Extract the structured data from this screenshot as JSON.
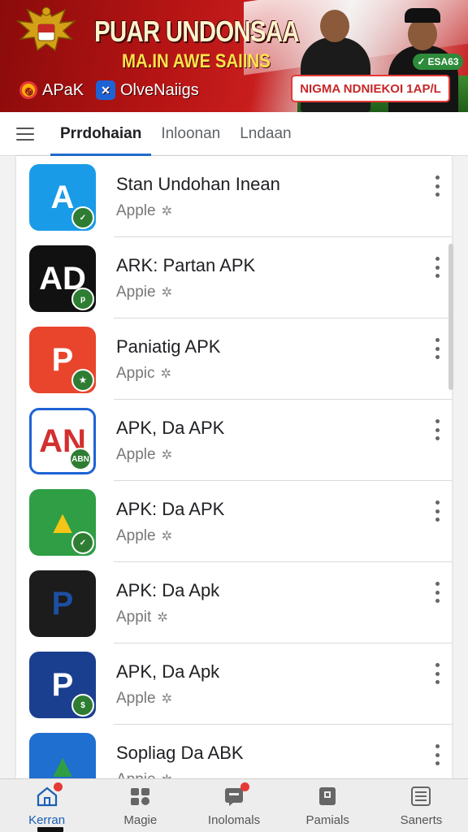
{
  "banner": {
    "title": "PUAR UNDONSAA",
    "subtitle": "MA.IN AWE SAIINS",
    "badge": "ESA63",
    "links": [
      {
        "label": "APaK",
        "icon": "target-app-icon"
      },
      {
        "label": "OlveNaiigs",
        "icon": "x-app-icon"
      }
    ],
    "cta": "NIGMA NDNIEKOI 1AP/L"
  },
  "tabs": [
    {
      "label": "Prrdohaian",
      "active": true
    },
    {
      "label": "Inloonan",
      "active": false
    },
    {
      "label": "Lndaan",
      "active": false
    }
  ],
  "apps": [
    {
      "title": "Stan Undohan Inean",
      "subtitle": "Apple",
      "icon": "A",
      "icon_bg": "#1a9be8",
      "icon_fg": "#ffffff",
      "mini": "✓"
    },
    {
      "title": "ARK: Partan APK",
      "subtitle": "Appie",
      "icon": "AD",
      "icon_bg": "#111111",
      "icon_fg": "#ffffff",
      "mini": "p"
    },
    {
      "title": "Paniatig APK",
      "subtitle": "Appic",
      "icon": "P",
      "icon_bg": "#e8452c",
      "icon_fg": "#ffffff",
      "mini": "★"
    },
    {
      "title": "APK, Da APK",
      "subtitle": "Apple",
      "icon": "AN",
      "icon_bg": "#ffffff",
      "icon_fg": "#d32f2f",
      "mini": "ABN"
    },
    {
      "title": "APK: Da APK",
      "subtitle": "Apple",
      "icon": "▲",
      "icon_bg": "#2f9e44",
      "icon_fg": "#f5c518",
      "mini": "✓"
    },
    {
      "title": "APK: Da Apk",
      "subtitle": "Appit",
      "icon": "P",
      "icon_bg": "#1c1c1c",
      "icon_fg": "#1d4fa3",
      "mini": ""
    },
    {
      "title": "APK, Da Apk",
      "subtitle": "Apple",
      "icon": "P",
      "icon_bg": "#1b3f8f",
      "icon_fg": "#ffffff",
      "mini": "$"
    },
    {
      "title": "Sopliag Da ABK",
      "subtitle": "Appie",
      "icon": "▲",
      "icon_bg": "#1f6fd1",
      "icon_fg": "#2f9e44",
      "mini": ""
    }
  ],
  "bottom_nav": [
    {
      "label": "Kerran",
      "icon": "home-icon",
      "active": true
    },
    {
      "label": "Magie",
      "icon": "apps-icon",
      "active": false
    },
    {
      "label": "Inolomals",
      "icon": "notifications-icon",
      "active": false
    },
    {
      "label": "Pamials",
      "icon": "library-icon",
      "active": false
    },
    {
      "label": "Sanerts",
      "icon": "menu-list-icon",
      "active": false
    }
  ]
}
